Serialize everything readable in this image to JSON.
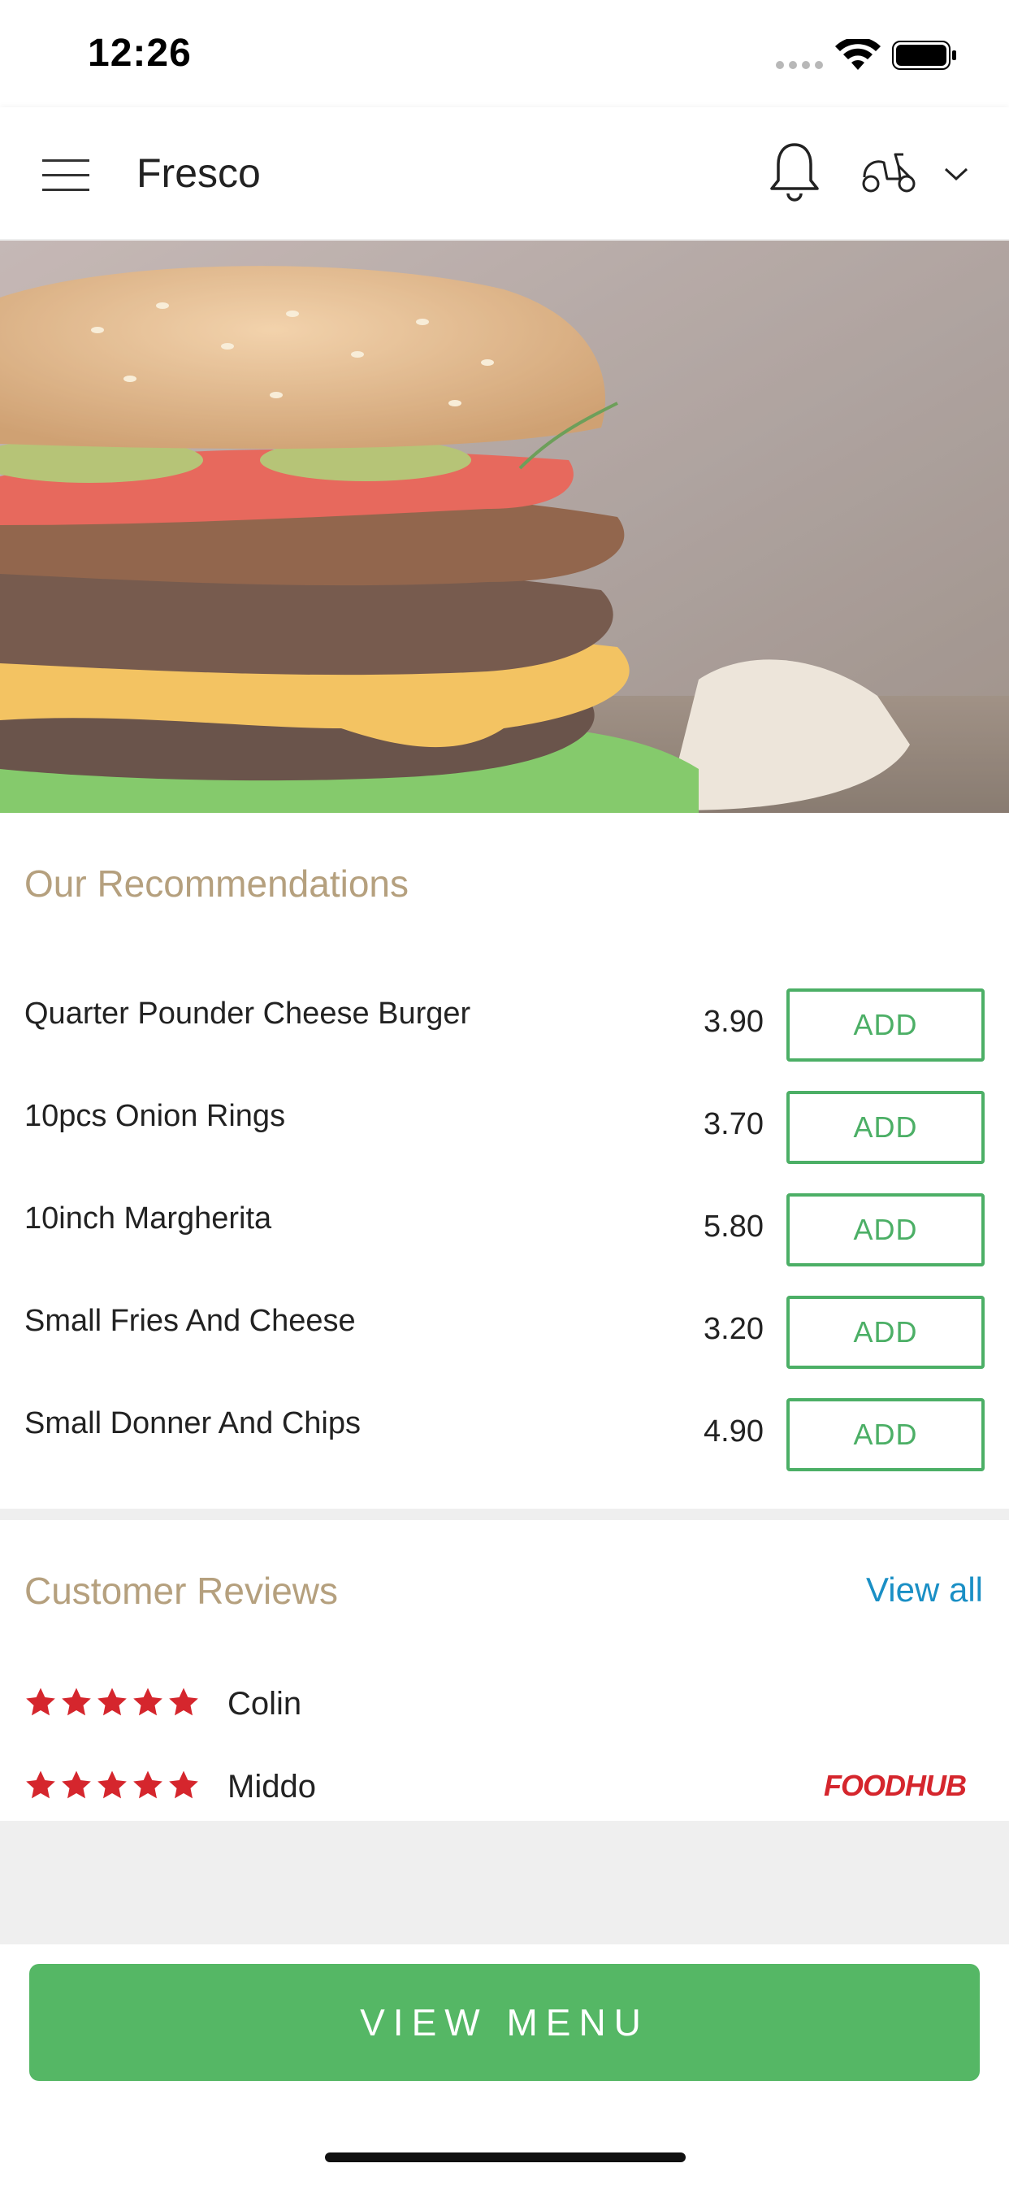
{
  "status_bar": {
    "time": "12:26"
  },
  "header": {
    "title": "Fresco",
    "icons": [
      "menu-icon",
      "bell-icon",
      "scooter-icon",
      "chevron-down-icon"
    ]
  },
  "hero": {
    "image": "burger-photo"
  },
  "recommendations": {
    "title": "Our Recommendations",
    "add_label": "ADD",
    "items": [
      {
        "name": "Quarter Pounder Cheese Burger",
        "price": "3.90"
      },
      {
        "name": "10pcs Onion Rings",
        "price": "3.70"
      },
      {
        "name": "10inch Margherita",
        "price": "5.80"
      },
      {
        "name": "Small Fries And Cheese",
        "price": "3.20"
      },
      {
        "name": "Small Donner And Chips",
        "price": "4.90"
      }
    ]
  },
  "reviews": {
    "title": "Customer Reviews",
    "view_all": "View all",
    "items": [
      {
        "name": "Colin",
        "rating": 5
      },
      {
        "name": "Middo",
        "rating": 5,
        "source": "FOODHUB"
      }
    ]
  },
  "footer": {
    "view_menu": "VIEW MENU"
  },
  "colors": {
    "accent_green": "#55b765",
    "section_title": "#b5a07e",
    "link_blue": "#1a8fc5",
    "star_red": "#d5262d"
  }
}
